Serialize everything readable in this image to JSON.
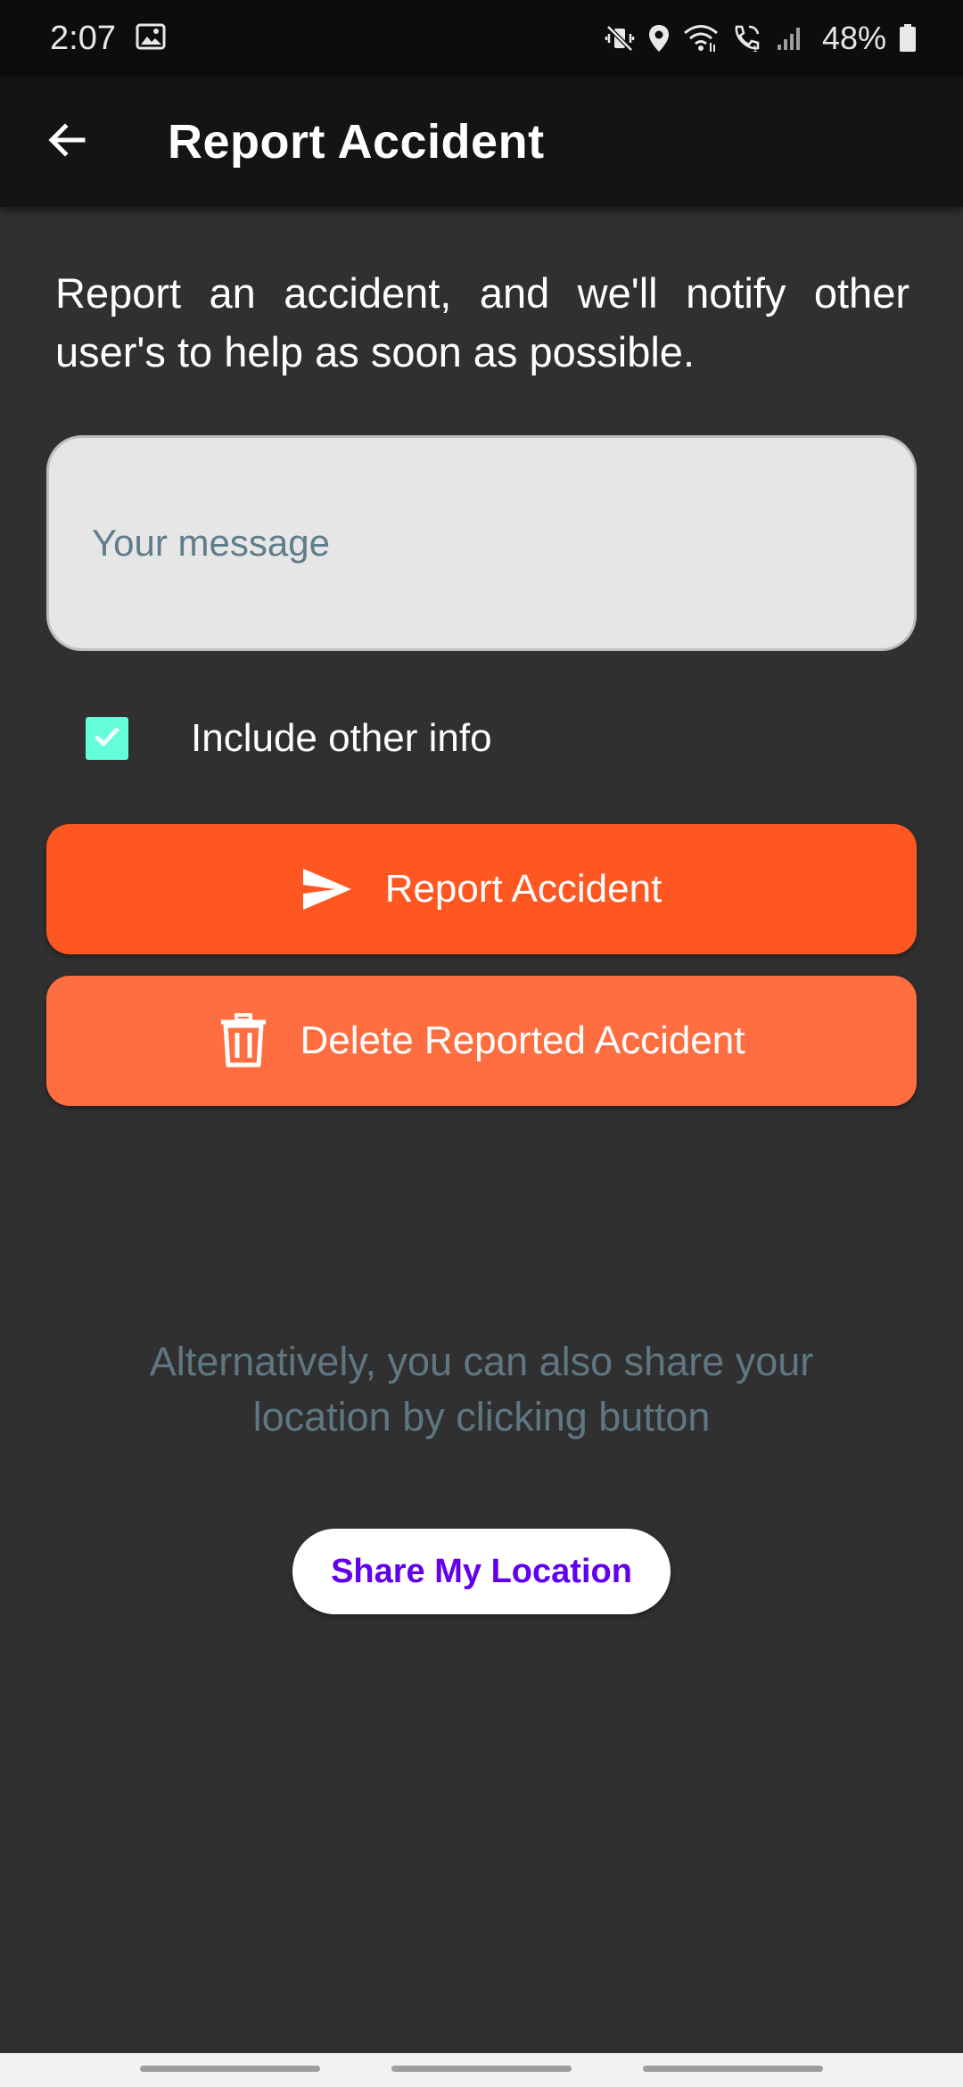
{
  "status_bar": {
    "time": "2:07",
    "battery": "48%",
    "icons": [
      "image-icon",
      "mute-vibrate-icon",
      "location-icon",
      "wifi-icon",
      "wifi-calling-icon",
      "signal-icon",
      "battery-icon"
    ]
  },
  "app_bar": {
    "back_icon": "arrow-back-icon",
    "title": "Report Accident"
  },
  "intro": {
    "text": "Report an accident, and we'll notify other user's to help as soon as possible."
  },
  "message_field": {
    "placeholder": "Your message",
    "value": ""
  },
  "include_info": {
    "label": "Include other info",
    "checked": true
  },
  "buttons": {
    "report": {
      "label": "Report Accident",
      "icon": "send-icon",
      "color": "#ff5722"
    },
    "delete": {
      "label": "Delete Reported Accident",
      "icon": "trash-icon",
      "color": "#ff6e40"
    }
  },
  "alternative": {
    "text": "Alternatively, you can also share your location by clicking button"
  },
  "share_button": {
    "label": "Share My Location",
    "color": "#6200ee"
  },
  "colors": {
    "background": "#303030",
    "app_bar": "#141414",
    "checkbox": "#64ffda",
    "field": "#e6e6e6"
  }
}
